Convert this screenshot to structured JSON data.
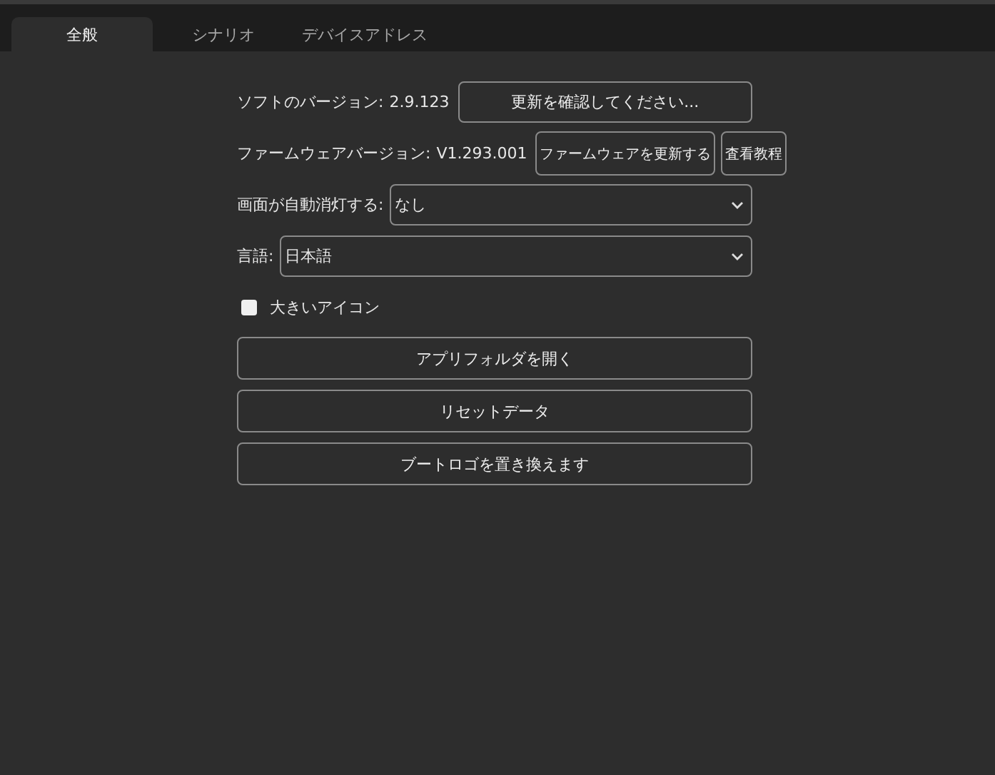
{
  "tabs": [
    {
      "label": "全般",
      "selected": true
    },
    {
      "label": "シナリオ",
      "selected": false
    },
    {
      "label": "デバイスアドレス",
      "selected": false
    }
  ],
  "software": {
    "label": "ソフトのバージョン:",
    "value": "2.9.123",
    "button": "更新を確認してください..."
  },
  "firmware": {
    "label": "ファームウェアバージョン:",
    "value": "V1.293.001",
    "buttons": [
      "ファームウェアを更新する",
      "査看教程"
    ]
  },
  "selects": [
    {
      "label": "画面が自動消灯する:",
      "value": "なし"
    },
    {
      "label": "言語:",
      "value": "日本語"
    }
  ],
  "large_icons": {
    "label": "大きいアイコン",
    "checked": false
  },
  "buttons": [
    "アプリフォルダを開く",
    "リセットデータ",
    "ブートロゴを置き換えます"
  ]
}
